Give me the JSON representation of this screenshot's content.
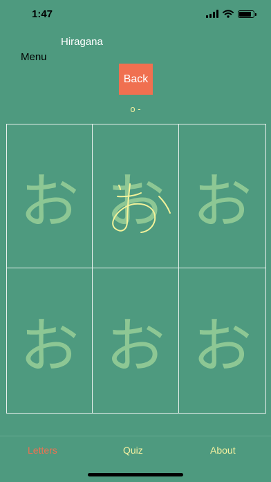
{
  "status": {
    "time": "1:47"
  },
  "header": {
    "title": "Hiragana",
    "menu_label": "Menu",
    "back_label": "Back",
    "romaji": "o -"
  },
  "grid": {
    "cells": [
      {
        "kana": "お",
        "traced": false
      },
      {
        "kana": "お",
        "traced": true
      },
      {
        "kana": "お",
        "traced": false
      },
      {
        "kana": "お",
        "traced": false
      },
      {
        "kana": "お",
        "traced": false
      },
      {
        "kana": "お",
        "traced": false
      }
    ]
  },
  "tabs": [
    {
      "label": "Letters",
      "active": true
    },
    {
      "label": "Quiz",
      "active": false
    },
    {
      "label": "About",
      "active": false
    }
  ],
  "colors": {
    "background": "#4e9a7f",
    "accent": "#f07050",
    "tab_text": "#f4f0a0",
    "kana_guide": "#98cf98",
    "trace_stroke": "#f2f29a"
  },
  "icons": [
    "cellular-signal-icon",
    "wifi-icon",
    "battery-icon"
  ]
}
